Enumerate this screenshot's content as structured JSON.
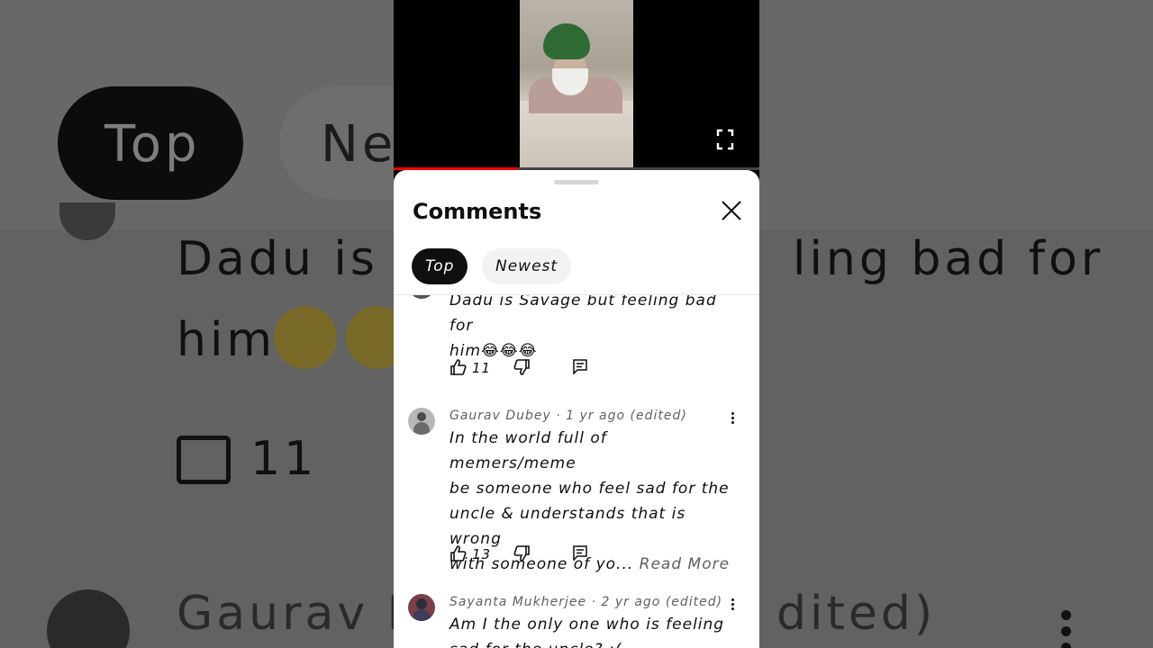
{
  "background": {
    "chips": [
      "Top",
      "Ne"
    ],
    "comment_line1": "Dadu is S",
    "comment_line1_right": "ling bad for",
    "comment_line2": "him",
    "like_count": "11",
    "author_partial": "Gaurav Du",
    "author_partial_right": "dited)"
  },
  "video": {
    "progress_fraction": 0.34
  },
  "sheet": {
    "title": "Comments",
    "chips": {
      "top": "Top",
      "newest": "Newest"
    }
  },
  "comments": [
    {
      "author_line": "",
      "text_line1": "Dadu is Savage but feeling bad for",
      "text_line2": "him😂😂😂",
      "likes": "11"
    },
    {
      "author_line": "Gaurav Dubey · 1 yr ago (edited)",
      "text_lines": [
        "In the world full of memers/meme",
        "be someone who feel sad for the",
        "uncle & understands that is wrong",
        "with someone of yo..."
      ],
      "read_more": "Read More",
      "likes": "13"
    },
    {
      "author_line": "Sayanta Mukherjee · 2 yr ago (edited)",
      "text_line1": "Am I the only one who is feeling",
      "text_line2": "sad for the uncle? :("
    }
  ],
  "colors": {
    "accent": "#ff0000",
    "chip_active": "#0f0f0f",
    "secondary_text": "#606060"
  }
}
